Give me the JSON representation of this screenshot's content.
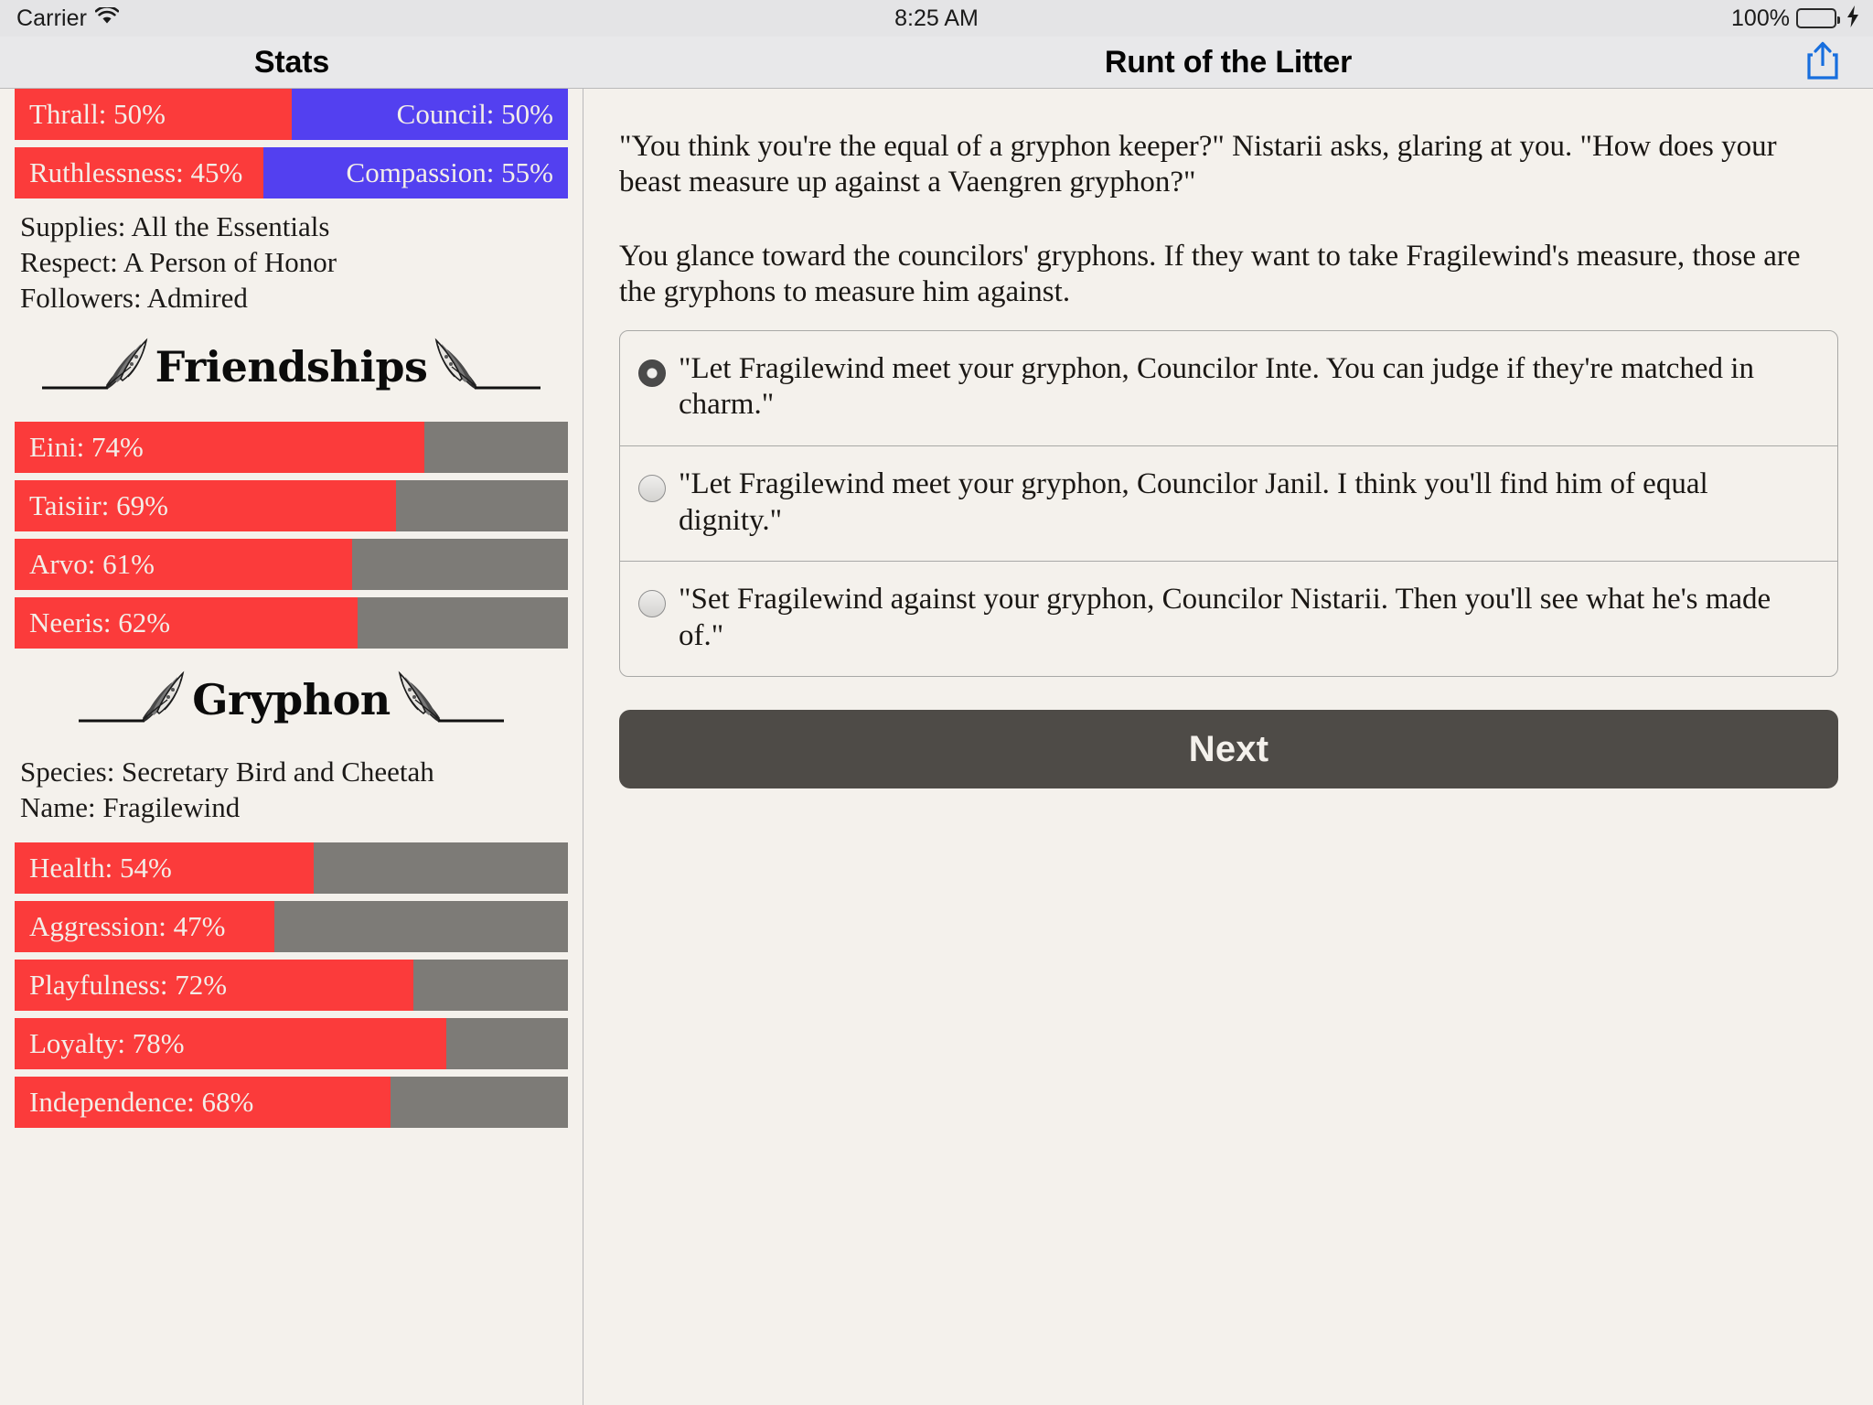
{
  "status_bar": {
    "carrier": "Carrier",
    "wifi_icon": "wifi-icon",
    "time": "8:25 AM",
    "battery_percent": "100%",
    "battery_icon": "battery-full-icon",
    "charging_icon": "lightning-bolt-icon"
  },
  "left_nav": {
    "title": "Stats"
  },
  "right_nav": {
    "title": "Runt of the Litter",
    "share_icon": "share-icon",
    "share_color": "#176ede"
  },
  "colors": {
    "bar_fill": "#fb3b3b",
    "bar_track": "#7d7b77",
    "opposed_left": "#fb3b3b",
    "opposed_right": "#5340f0",
    "page_bg": "#f4f1ec",
    "chrome_bg": "#e8e8ea",
    "button_bg": "#4e4b47",
    "battery_green": "#35d04a"
  },
  "stats": {
    "opposed_bars": [
      {
        "left_label": "Thrall: 50%",
        "left_value": 50,
        "right_label": "Council: 50%",
        "right_value": 50
      },
      {
        "left_label": "Ruthlessness: 45%",
        "left_value": 45,
        "right_label": "Compassion: 55%",
        "right_value": 55
      }
    ],
    "text_stats": [
      "Supplies: All the Essentials",
      "Respect: A Person of Honor",
      "Followers: Admired"
    ],
    "friendships": {
      "header": "Friendships",
      "ornament_icon": "leaf-ornament-icon",
      "bars": [
        {
          "label": "Eini: 74%",
          "value": 74
        },
        {
          "label": "Taisiir: 69%",
          "value": 69
        },
        {
          "label": "Arvo: 61%",
          "value": 61
        },
        {
          "label": "Neeris: 62%",
          "value": 62
        }
      ]
    },
    "gryphon": {
      "header": "Gryphon",
      "ornament_icon": "leaf-ornament-icon",
      "text_stats": [
        "Species: Secretary Bird and Cheetah",
        "Name: Fragilewind"
      ],
      "bars": [
        {
          "label": "Health: 54%",
          "value": 54
        },
        {
          "label": "Aggression: 47%",
          "value": 47
        },
        {
          "label": "Playfulness: 72%",
          "value": 72
        },
        {
          "label": "Loyalty: 78%",
          "value": 78
        },
        {
          "label": "Independence: 68%",
          "value": 68
        }
      ]
    }
  },
  "story": {
    "paragraphs": [
      "\"You think you're the equal of a gryphon keeper?\" Nistarii asks, glaring at you. \"How does your beast measure up against a Vaengren gryphon?\"",
      "You glance toward the councilors' gryphons. If they want to take Fragilewind's measure, those are the gryphons to measure him against."
    ]
  },
  "choices": [
    {
      "text": "\"Let Fragilewind meet your gryphon, Councilor Inte. You can judge if they're matched in charm.\"",
      "selected": true
    },
    {
      "text": "\"Let Fragilewind meet your gryphon, Councilor Janil. I think you'll find him of equal dignity.\"",
      "selected": false
    },
    {
      "text": "\"Set Fragilewind against your gryphon, Councilor Nistarii. Then you'll see what he's made of.\"",
      "selected": false
    }
  ],
  "next_button": {
    "label": "Next"
  }
}
